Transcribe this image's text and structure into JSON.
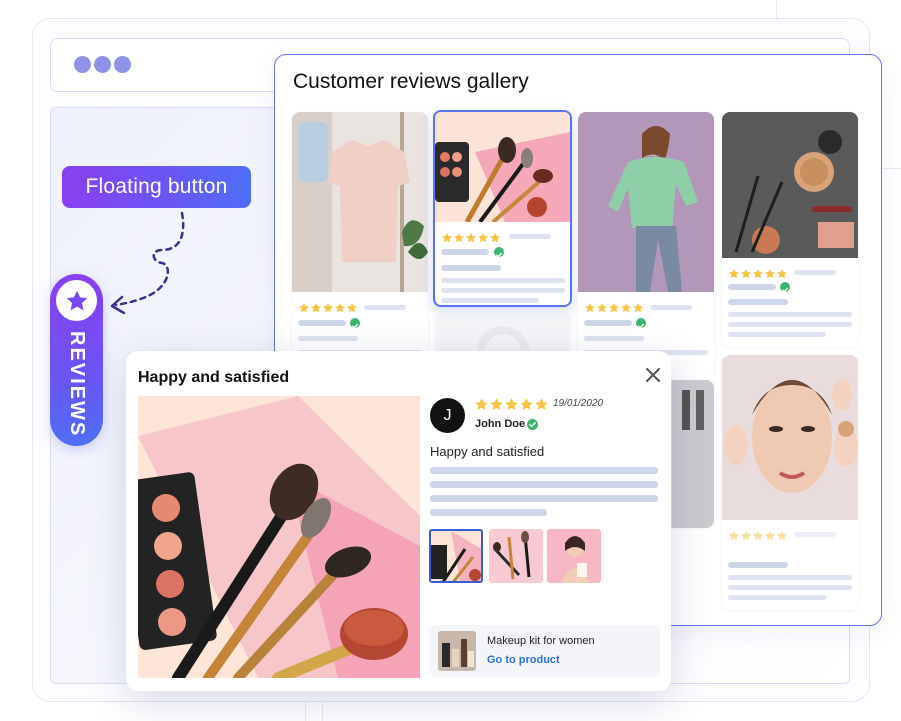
{
  "window": {
    "dots": 3
  },
  "callout": {
    "label": "Floating button"
  },
  "floating_tab": {
    "label": "REVIEWS",
    "icon": "star-icon"
  },
  "gallery": {
    "title": "Customer reviews gallery"
  },
  "popup": {
    "title": "Happy and satisfied",
    "close_icon": "close-icon",
    "review": {
      "avatar_initial": "J",
      "date": "19/01/2020",
      "author": "John Doe",
      "verified_icon": "check-circle-icon",
      "headline": "Happy and satisfied",
      "rating": 5
    },
    "product": {
      "name": "Makeup kit for women",
      "link_label": "Go to product"
    }
  },
  "colors": {
    "accent_purple": "#8a3ff0",
    "accent_blue": "#4f6ef7",
    "star": "#f6c343",
    "link": "#2b6fd8",
    "verified": "#3cb371"
  }
}
